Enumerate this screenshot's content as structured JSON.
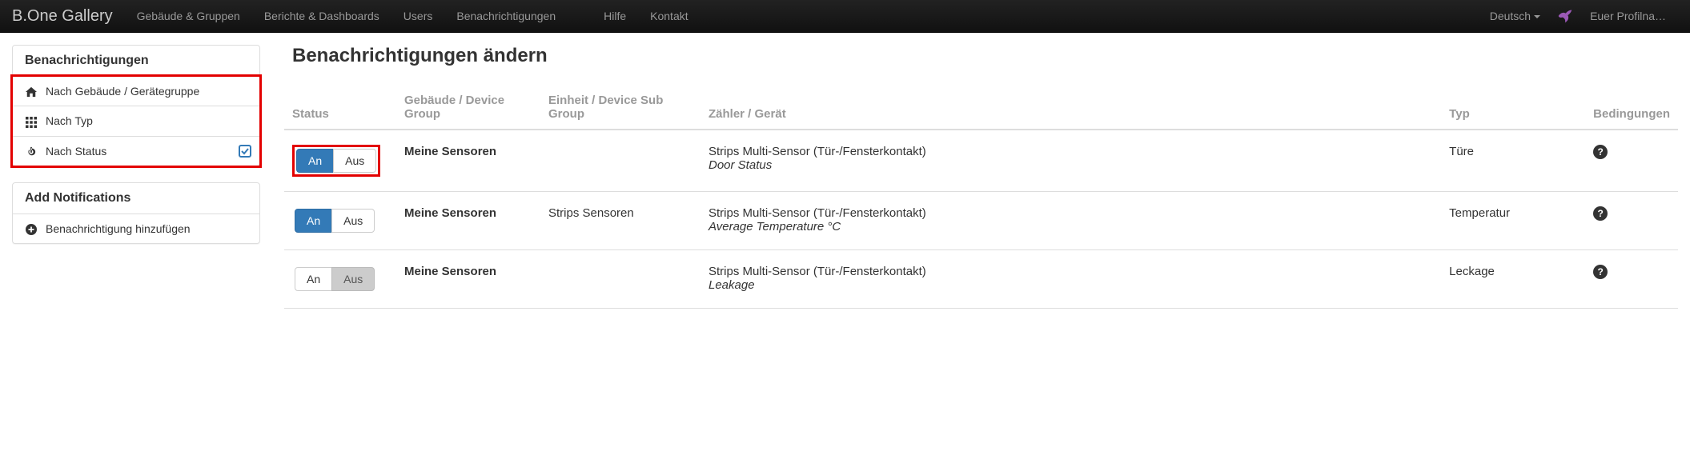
{
  "navbar": {
    "brand": "B.One Gallery",
    "items": [
      "Gebäude & Gruppen",
      "Berichte & Dashboards",
      "Users",
      "Benachrichtigungen"
    ],
    "right_items": [
      "Hilfe",
      "Kontakt"
    ],
    "lang": "Deutsch",
    "profile": "Euer Profilna…"
  },
  "sidebar": {
    "panel1_title": "Benachrichtigungen",
    "nav": [
      {
        "icon": "home",
        "label": "Nach Gebäude / Gerätegruppe",
        "checked": false
      },
      {
        "icon": "grid",
        "label": "Nach Typ",
        "checked": false
      },
      {
        "icon": "power",
        "label": "Nach Status",
        "checked": true
      }
    ],
    "panel2_title": "Add Notifications",
    "add_label": "Benachrichtigung hinzufügen"
  },
  "main": {
    "title": "Benachrichtigungen ändern",
    "columns": {
      "status": "Status",
      "group": "Gebäude / Device Group",
      "subgroup": "Einheit / Device Sub Group",
      "device": "Zähler / Gerät",
      "type": "Typ",
      "cond": "Bedingungen"
    },
    "toggle_on": "An",
    "toggle_off": "Aus",
    "rows": [
      {
        "on": true,
        "highlight": true,
        "group": "Meine Sensoren",
        "subgroup": "",
        "device": "Strips Multi-Sensor (Tür-/Fensterkontakt)",
        "device_sub": "Door Status",
        "type": "Türe"
      },
      {
        "on": true,
        "highlight": false,
        "group": "Meine Sensoren",
        "subgroup": "Strips Sensoren",
        "device": "Strips Multi-Sensor (Tür-/Fensterkontakt)",
        "device_sub": "Average Temperature °C",
        "type": "Temperatur"
      },
      {
        "on": false,
        "highlight": false,
        "group": "Meine Sensoren",
        "subgroup": "",
        "device": "Strips Multi-Sensor (Tür-/Fensterkontakt)",
        "device_sub": "Leakage",
        "type": "Leckage"
      }
    ]
  }
}
